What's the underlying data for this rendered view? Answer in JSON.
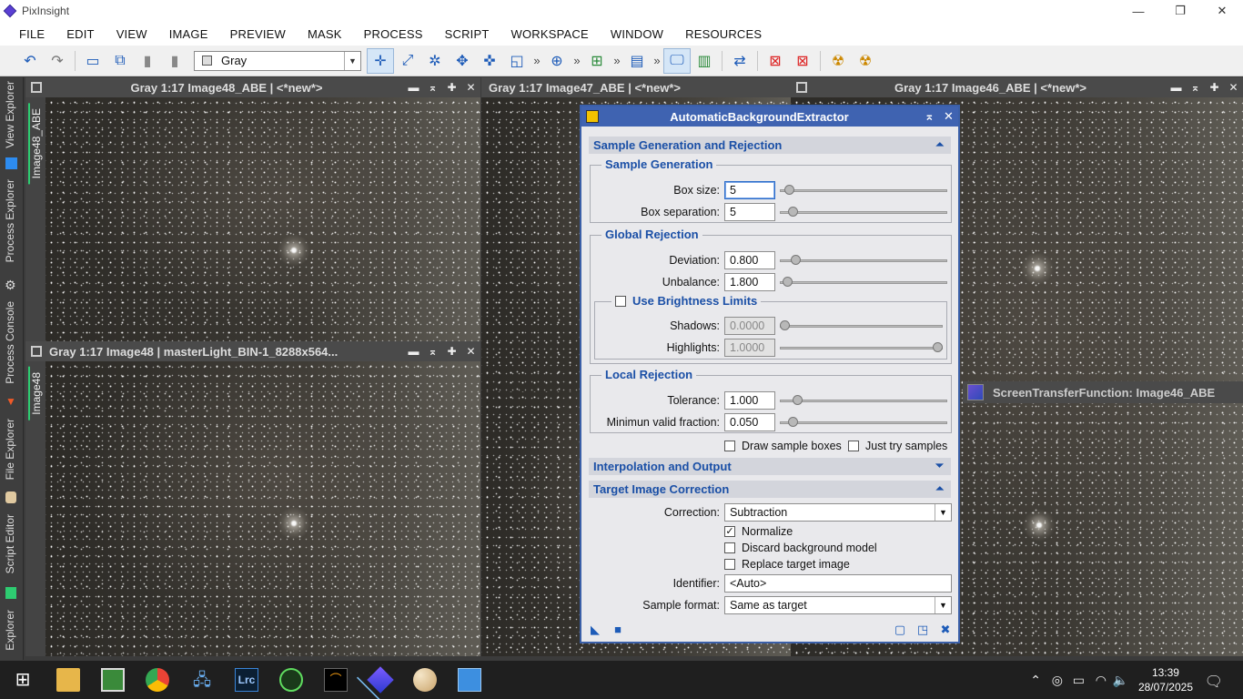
{
  "app": {
    "title": "PixInsight"
  },
  "window_controls": {
    "minimize": "—",
    "maximize": "❐",
    "close": "✕"
  },
  "menu": [
    "FILE",
    "EDIT",
    "VIEW",
    "IMAGE",
    "PREVIEW",
    "MASK",
    "PROCESS",
    "SCRIPT",
    "WORKSPACE",
    "WINDOW",
    "RESOURCES"
  ],
  "toolbar": {
    "view_selector": "Gray",
    "more": "»",
    "icons": [
      "undo-icon",
      "redo-icon",
      "new-image-icon",
      "duplicate-icon",
      "copy-icon",
      "paste-icon",
      "readout-mode-icon",
      "zoom-fit-icon",
      "pan-icon",
      "move-icon",
      "center-icon",
      "crop-icon",
      "zoom-in-icon",
      "new-preview-icon",
      "stf-icon",
      "screen-icon",
      "histogram-icon",
      "link-icon",
      "mask-icon",
      "mask-remove-icon",
      "display-icon",
      "auto-stretch-icon"
    ]
  },
  "sidebar": {
    "tabs": [
      "View Explorer",
      "Process Explorer",
      "Process Console",
      "File Explorer",
      "Script Editor",
      "Explorer"
    ]
  },
  "windows": [
    {
      "title": "Gray 1:17 Image48_ABE | <*new*>",
      "tab": "Image48_ABE"
    },
    {
      "title": "Gray 1:17 Image48 | masterLight_BIN-1_8288x564...",
      "tab": "Image48"
    },
    {
      "title": "Gray 1:17 Image47_ABE | <*new*>"
    },
    {
      "title": "Gray 1:17 Image46_ABE | <*new*>"
    }
  ],
  "title_buttons": {
    "shade": "▬",
    "collapse": "⌅",
    "maximize": "✚",
    "close": "✕"
  },
  "dialog": {
    "title": "AutomaticBackgroundExtractor",
    "collapse": "⌅",
    "close": "✕",
    "sections": {
      "sample_gen_rejection": "Sample Generation and Rejection",
      "interpolation_output": "Interpolation and Output",
      "target_correction": "Target Image Correction"
    },
    "arrows": {
      "up": "⏶",
      "down": "⏷"
    },
    "sample_generation": {
      "label": "Sample Generation",
      "box_size_label": "Box size:",
      "box_size": "5",
      "box_separation_label": "Box separation:",
      "box_separation": "5"
    },
    "global_rejection": {
      "label": "Global Rejection",
      "deviation_label": "Deviation:",
      "deviation": "0.800",
      "unbalance_label": "Unbalance:",
      "unbalance": "1.800",
      "brightness_limits_label": "Use Brightness Limits",
      "shadows_label": "Shadows:",
      "shadows": "0.0000",
      "highlights_label": "Highlights:",
      "highlights": "1.0000"
    },
    "local_rejection": {
      "label": "Local Rejection",
      "tolerance_label": "Tolerance:",
      "tolerance": "1.000",
      "min_valid_label": "Minimun valid fraction:",
      "min_valid": "0.050"
    },
    "draw_sample_boxes": "Draw sample boxes",
    "just_try_samples": "Just try samples",
    "correction": {
      "label": "Correction:",
      "value": "Subtraction",
      "normalize": "Normalize",
      "discard_model": "Discard background model",
      "replace_target": "Replace target image",
      "identifier_label": "Identifier:",
      "identifier": "<Auto>",
      "sample_format_label": "Sample format:",
      "sample_format": "Same as target"
    },
    "sliders": {
      "box_size": 0.03,
      "box_separation": 0.05,
      "deviation": 0.07,
      "unbalance": 0.02,
      "shadows": 0.0,
      "highlights": 1.0,
      "tolerance": 0.08,
      "min_valid": 0.05
    }
  },
  "stf": {
    "title": "ScreenTransferFunction: Image46_ABE"
  },
  "taskbar": {
    "time": "13:39",
    "date": "28/07/2025",
    "lrc": "Lrc",
    "apps": [
      "windows-start-icon",
      "file-explorer-icon",
      "spreadsheet-icon",
      "chrome-icon",
      "network-app-icon",
      "lightroom-icon",
      "media-app-icon",
      "sketch-app-icon",
      "pixinsight-icon",
      "paint-icon",
      "window-app-icon"
    ]
  },
  "colors": {
    "accent": "#3f63b1",
    "section_text": "#1a4fa6",
    "tab_active": "#2ecc71"
  }
}
